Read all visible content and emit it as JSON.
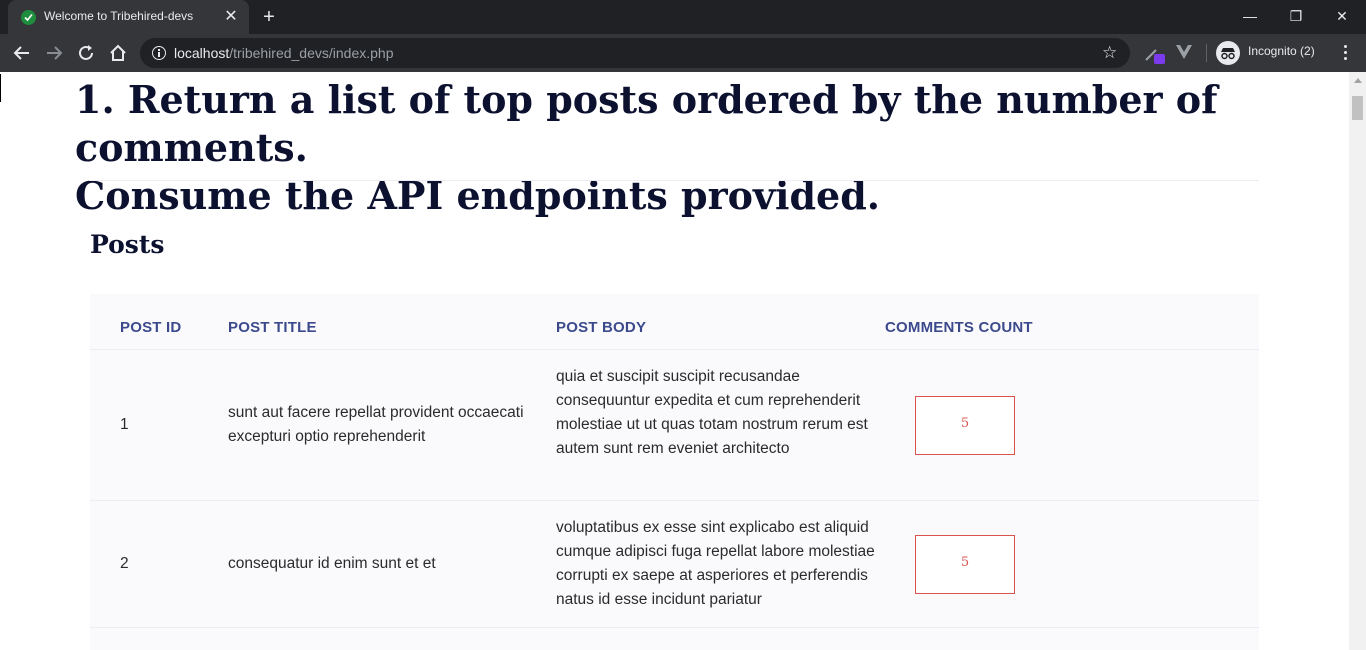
{
  "browser": {
    "tab_title": "Welcome to Tribehired-devs",
    "url_host": "localhost",
    "url_path": "/tribehired_devs/index.php",
    "incognito_label": "Incognito (2)"
  },
  "page": {
    "heading_line1": "1. Return a list of top posts ordered by the number of comments.",
    "heading_line2": "Consume the API endpoints provided.",
    "section_title": "Posts"
  },
  "table": {
    "headers": [
      "POST ID",
      "POST TITLE",
      "POST BODY",
      "COMMENTS COUNT"
    ],
    "rows": [
      {
        "id": "1",
        "title": "sunt aut facere repellat provident occaecati excepturi optio reprehenderit",
        "body": "quia et suscipit suscipit recusandae consequuntur expedita et cum reprehenderit molestiae ut ut quas totam nostrum rerum est autem sunt rem eveniet architecto",
        "comments": "5"
      },
      {
        "id": "2",
        "title": "consequatur id enim sunt et et",
        "body": "voluptatibus ex esse sint explicabo est aliquid cumque adipisci fuga repellat labore molestiae corrupti ex saepe at asperiores et perferendis natus id esse incidunt pariatur",
        "comments": "5"
      }
    ]
  },
  "colors": {
    "header_text": "#3c4a8c",
    "count_accent": "#d9534f",
    "chrome_dark": "#202124"
  }
}
